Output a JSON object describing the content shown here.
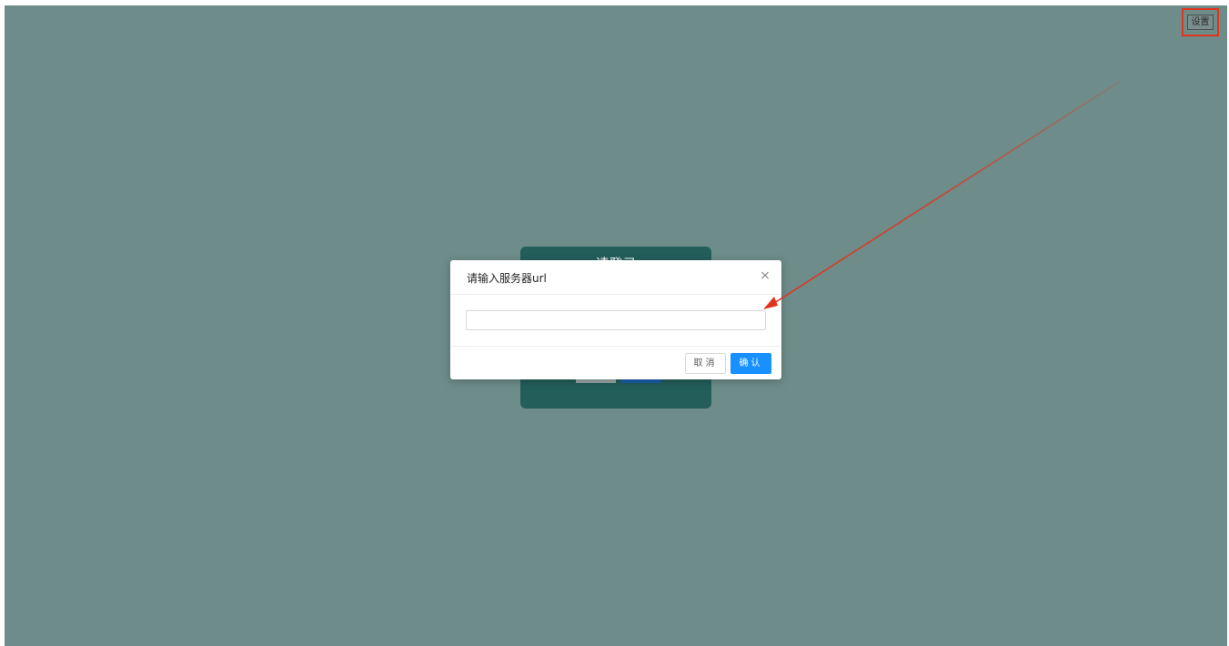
{
  "settings": {
    "label": "设置"
  },
  "login_card": {
    "title": "请登录"
  },
  "modal": {
    "title": "请输入服务器url",
    "close_glyph": "×",
    "input_value": "",
    "input_placeholder": "",
    "cancel_label": "取消",
    "ok_label": "确认"
  },
  "colors": {
    "backdrop": "#6e8c89",
    "login_card": "#235e5b",
    "primary": "#1890ff",
    "annotation": "#e0341f"
  },
  "icons": {
    "close": "close-icon",
    "arrow": "annotation-arrow"
  }
}
